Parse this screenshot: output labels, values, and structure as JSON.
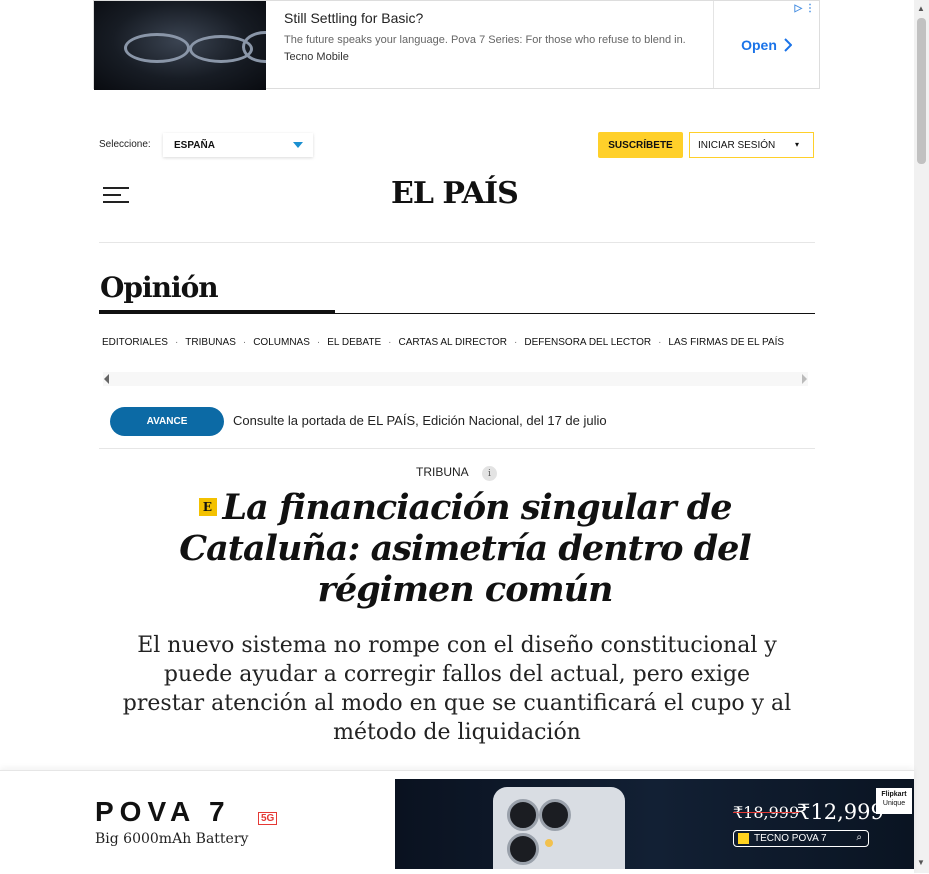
{
  "top_ad": {
    "title": "Still Settling for Basic?",
    "description": "The future speaks your language. Pova 7 Series: For those who refuse to blend in.",
    "brand": "Tecno Mobile",
    "cta": "Open",
    "cta_icon": "chevron-right-icon"
  },
  "header": {
    "select_label": "Seleccione:",
    "country": "ESPAÑA",
    "subscribe": "SUSCRÍBETE",
    "login": "INICIAR SESIÓN",
    "login_caret": "▾",
    "logo": "EL PAÍS",
    "accent_color": "#ffd02a"
  },
  "section": {
    "title": "Opinión",
    "nav": [
      "EDITORIALES",
      "TRIBUNAS",
      "COLUMNAS",
      "EL DEBATE",
      "CARTAS AL DIRECTOR",
      "DEFENSORA DEL LECTOR",
      "LAS FIRMAS DE EL PAÍS"
    ]
  },
  "avance": {
    "button": "AVANCE",
    "text": "Consulte la portada de EL PAÍS, Edición Nacional, del 17 de julio",
    "button_color": "#0c6aa5"
  },
  "article": {
    "kicker": "TRIBUNA",
    "info_icon": "i",
    "badge": "E",
    "headline": "La financiación singular de Cataluña: asimetría dentro del régimen común",
    "subhead": "El nuevo sistema no rompe con el diseño constitucional y puede ayudar a corregir fallos del actual, pero exige prestar atención al modo en que se cuantificará el cupo y al método de liquidación"
  },
  "bottom_ad": {
    "product": "POVA 7",
    "badge": "5G",
    "tagline": "Big 6000mAh Battery",
    "old_price": "₹18,999",
    "new_price": "₹12,999",
    "search_text": "TECNO POVA 7",
    "retailer": "Flipkart",
    "retailer_sub": "Unique"
  }
}
